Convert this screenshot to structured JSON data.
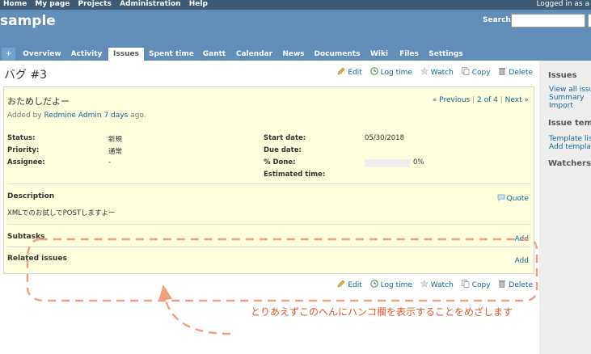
{
  "top_menu": {
    "links": [
      "Home",
      "My page",
      "Projects",
      "Administration",
      "Help"
    ],
    "logged_as": "Logged in as a"
  },
  "header": {
    "project_title": "sample",
    "search_label": "Search:"
  },
  "main_menu": {
    "plus": "+",
    "tabs": [
      "Overview",
      "Activity",
      "Issues",
      "Spent time",
      "Gantt",
      "Calendar",
      "News",
      "Documents",
      "Wiki",
      "Files",
      "Settings"
    ],
    "selected": "Issues"
  },
  "contextual": {
    "edit": "Edit",
    "log_time": "Log time",
    "watch": "Watch",
    "copy": "Copy",
    "delete": "Delete"
  },
  "issue": {
    "heading": "バグ #3",
    "subject": "おためしだよー",
    "nav": {
      "previous": "« Previous",
      "position": "2 of 4",
      "next": "Next »"
    },
    "author_prefix": "Added by ",
    "author": "Redmine Admin",
    "age": "7 days",
    "age_suffix": " ago.",
    "attributes": {
      "status_label": "Status:",
      "status": "新規",
      "priority_label": "Priority:",
      "priority": "通常",
      "assignee_label": "Assignee:",
      "assignee": "-",
      "start_date_label": "Start date:",
      "start_date": "05/30/2018",
      "due_date_label": "Due date:",
      "due_date": "",
      "done_label": "% Done:",
      "done": "0%",
      "done_ratio": 0,
      "estimated_label": "Estimated time:",
      "estimated": ""
    },
    "description_label": "Description",
    "quote": "Quote",
    "description": "XMLでのお試しでPOSTしますよー",
    "subtasks_label": "Subtasks",
    "related_label": "Related issues",
    "add": "Add"
  },
  "sidebar": {
    "issues_heading": "Issues",
    "view_all": "View all issue",
    "summary": "Summary",
    "import": "Import",
    "templates_heading": "Issue templ",
    "template_list": "Template list",
    "add_template": "Add template",
    "watchers_heading": "Watchers ("
  },
  "annotation": {
    "text": "とりあえずこのへんにハンコ欄を表示することをめざします",
    "color": "#f0a080"
  }
}
